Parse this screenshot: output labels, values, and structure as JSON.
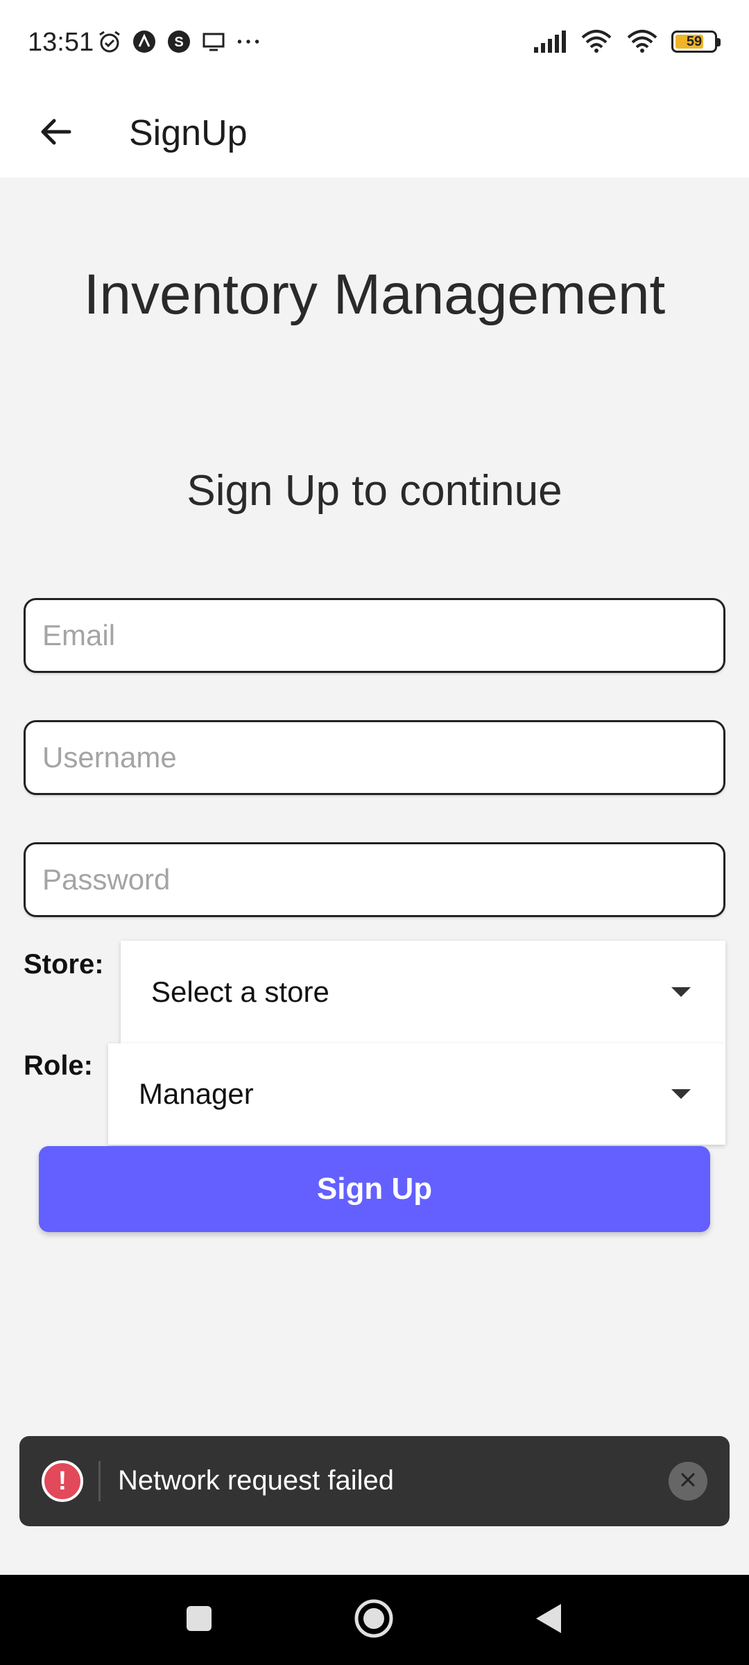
{
  "status_bar": {
    "time": "13:51",
    "left_icons": [
      "alarm-icon",
      "app-a-icon",
      "app-s-icon",
      "screen-icon",
      "more-dots-icon"
    ],
    "right_icons": [
      "signal-icon",
      "wifi-icon",
      "wifi-icon"
    ],
    "battery": "59"
  },
  "app_bar": {
    "title": "SignUp",
    "back_icon": "arrow-left-icon"
  },
  "main": {
    "heading": "Inventory Management",
    "subheading": "Sign Up to continue",
    "email_placeholder": "Email",
    "username_placeholder": "Username",
    "password_placeholder": "Password",
    "store_label": "Store:",
    "store_value": "Select a store",
    "role_label": "Role:",
    "role_value": "Manager",
    "signup_button": "Sign Up"
  },
  "toast": {
    "message": "Network request failed",
    "icon": "error-icon",
    "close_icon": "close-icon",
    "accent_color": "#e2495a"
  },
  "colors": {
    "primary": "#6360ff",
    "toast_bg": "#333333"
  }
}
